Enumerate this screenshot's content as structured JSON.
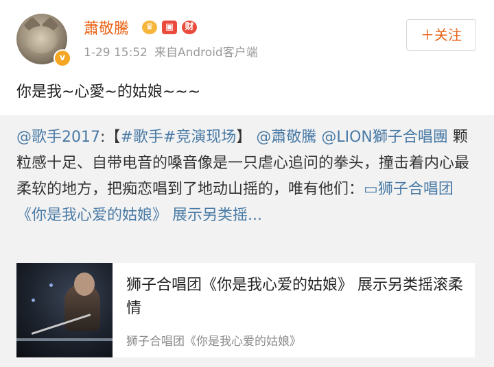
{
  "post": {
    "username": "蕭敬騰",
    "badges": {
      "crown": "♛",
      "redpack": "▣",
      "cai": "财"
    },
    "verified_mark": "v",
    "time": "1-29 15:52",
    "source": "来自Android客户端",
    "follow_label": "＋关注",
    "text": "你是我~心愛~的姑娘~~~"
  },
  "retweet": {
    "mention_singer": "@歌手2017",
    "colon": ":",
    "hashtag_open": "【",
    "hashtag_singer": "#歌手#",
    "hashtag_stage": "竞演现场",
    "hashtag_close": "】",
    "mention_xiao": "@蕭敬騰",
    "mention_lion": "@LION獅子合唱團",
    "body": "颗粒感十足、自带电音的嗓音像是一只虐心追问的拳头，撞击着内心最柔软的地方，把痴恋唱到了地动山摇的，唯有他们：",
    "video_icon": "▭",
    "video_link": "狮子合唱团《你是我心爱的姑娘》 展示另类摇...",
    "card": {
      "title": "狮子合唱团《你是我心爱的姑娘》 展示另类摇滚柔情",
      "subtitle": "狮子合唱团《你是我心爱的姑娘》"
    }
  },
  "colors": {
    "username": "#e86418",
    "link": "#4a7ba6",
    "meta": "#9a9a9a",
    "retweet_bg": "#f2f2f2"
  }
}
